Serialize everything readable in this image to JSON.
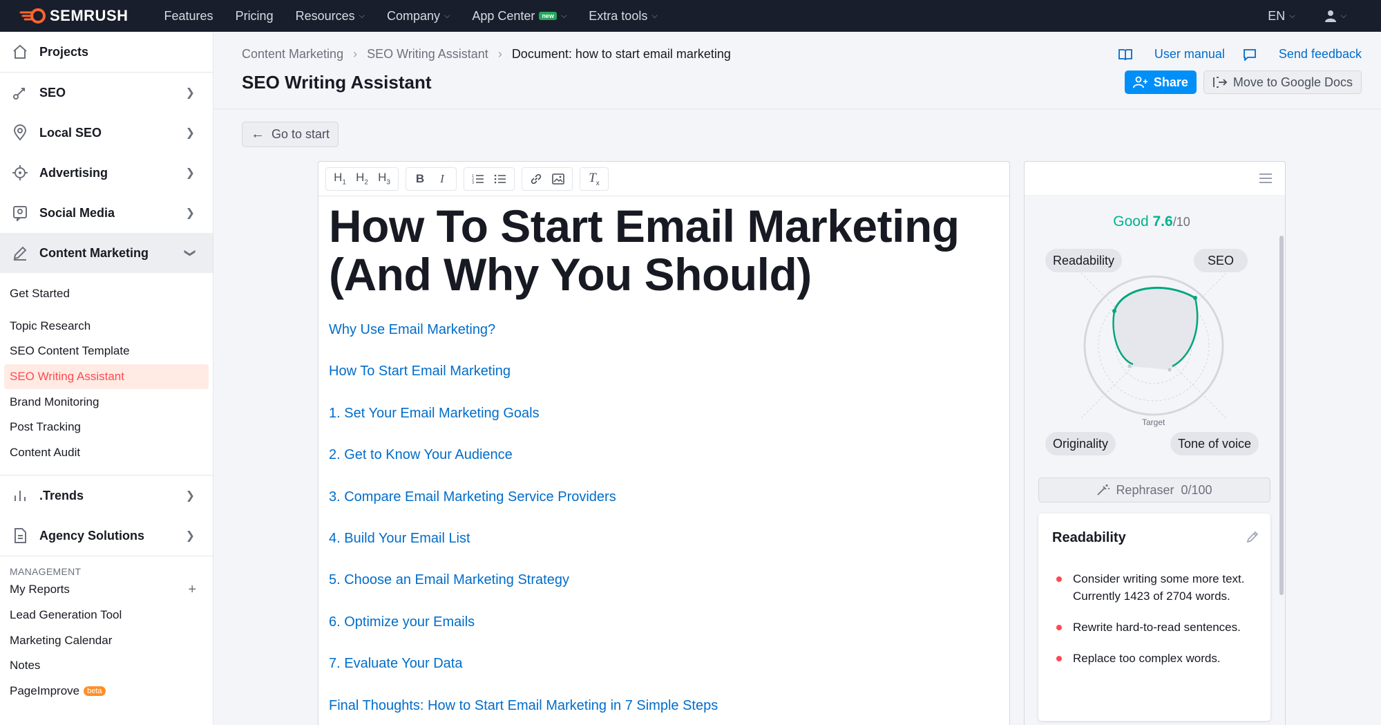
{
  "topnav": {
    "brand": "SEMRUSH",
    "items": [
      {
        "label": "Features",
        "dropdown": false
      },
      {
        "label": "Pricing",
        "dropdown": false
      },
      {
        "label": "Resources",
        "dropdown": true
      },
      {
        "label": "Company",
        "dropdown": true
      },
      {
        "label": "App Center",
        "dropdown": true,
        "badge": "new"
      },
      {
        "label": "Extra tools",
        "dropdown": true
      }
    ],
    "language": "EN"
  },
  "sidebar": {
    "main_items": [
      {
        "label": "Projects",
        "icon": "home-icon"
      },
      {
        "label": "SEO",
        "icon": "seo-icon"
      },
      {
        "label": "Local SEO",
        "icon": "location-pin-icon"
      },
      {
        "label": "Advertising",
        "icon": "target-icon"
      },
      {
        "label": "Social Media",
        "icon": "social-icon"
      },
      {
        "label": "Content Marketing",
        "icon": "pencil-icon"
      }
    ],
    "content_marketing_items": [
      "Get Started",
      "Topic Research",
      "SEO Content Template",
      "SEO Writing Assistant",
      "Brand Monitoring",
      "Post Tracking",
      "Content Audit"
    ],
    "trends": ".Trends",
    "agency": "Agency Solutions",
    "management_label": "MANAGEMENT",
    "management_items": [
      "My Reports",
      "Lead Generation Tool",
      "Marketing Calendar",
      "Notes",
      "PageImprove"
    ],
    "beta_badge": "beta"
  },
  "header": {
    "breadcrumb": [
      "Content Marketing",
      "SEO Writing Assistant",
      "Document: how to start email marketing"
    ],
    "title": "SEO Writing Assistant",
    "user_manual": "User manual",
    "send_feedback": "Send feedback",
    "share": "Share",
    "move_to_gdocs": "Move to Google Docs"
  },
  "go_to_start": "Go to start",
  "editor": {
    "toolbar": [
      "H1",
      "H2",
      "H3",
      "bold-icon",
      "italic-icon",
      "ordered-list-icon",
      "bullet-list-icon",
      "link-icon",
      "image-icon",
      "clear-format-icon"
    ],
    "heading": "How To Start Email Marketing (And Why You Should)",
    "toc": [
      "Why Use Email Marketing?",
      "How To Start Email Marketing",
      "1. Set Your Email Marketing Goals",
      "2. Get to Know Your Audience",
      "3. Compare Email Marketing Service Providers",
      "4. Build Your Email List",
      "5. Choose an Email Marketing Strategy",
      "6. Optimize your Emails",
      "7. Evaluate Your Data",
      "Final Thoughts: How to Start Email Marketing in 7 Simple Steps"
    ]
  },
  "panel": {
    "score_label": "Good",
    "score_value": "7.6",
    "score_max": "/10",
    "pills": {
      "readability": "Readability",
      "seo": "SEO",
      "originality": "Originality",
      "tone": "Tone of voice"
    },
    "target_label": "Target",
    "rephraser": "Rephraser",
    "rephraser_count": "0/100",
    "card_title": "Readability",
    "card_items": [
      "Consider writing some more text. Currently 1423 of 2704 words.",
      "Rewrite hard-to-read sentences.",
      "Replace too complex words."
    ]
  },
  "colors": {
    "accent_orange": "#ff642d",
    "link_blue": "#006dca",
    "score_green": "#00b38f",
    "share_blue": "#008ff8"
  }
}
